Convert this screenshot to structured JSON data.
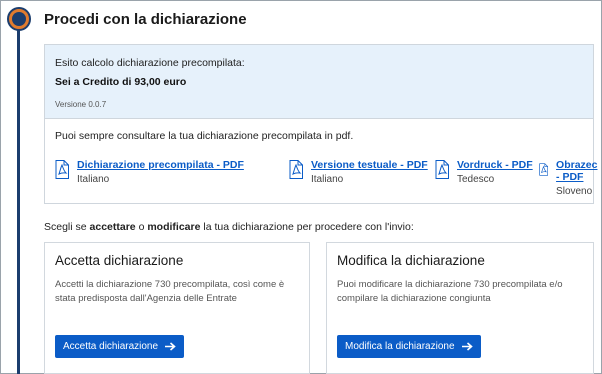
{
  "page_title": "Procedi con la dichiarazione",
  "summary": {
    "esito_label": "Esito calcolo dichiarazione precompilata:",
    "esito_value": "Sei a Credito di 93,00 euro",
    "version": "Versione 0.0.7"
  },
  "pdf_section": {
    "intro": "Puoi sempre consultare la tua dichiarazione precompilata in pdf.",
    "items": [
      {
        "name": "Dichiarazione precompilata - PDF",
        "lang": "Italiano"
      },
      {
        "name": "Versione testuale - PDF",
        "lang": "Italiano"
      },
      {
        "name": "Vordruck - PDF",
        "lang": "Tedesco"
      },
      {
        "name": "Obrazec - PDF",
        "lang": "Sloveno"
      }
    ]
  },
  "choose": {
    "before": "Scegli se ",
    "accept_word": "accettare",
    "middle": " o ",
    "modify_word": "modificare",
    "after": " la tua dichiarazione per procedere con l'invio:"
  },
  "cards": {
    "accept": {
      "title": "Accetta dichiarazione",
      "desc": "Accetti la dichiarazione 730 precompilata, così come è stata predisposta dall'Agenzia delle Entrate",
      "button": "Accetta dichiarazione"
    },
    "modify": {
      "title": "Modifica la dichiarazione",
      "desc": "Puoi modificare la dichiarazione 730 precompilata e/o compilare la dichiarazione congiunta",
      "button": "Modifica la dichiarazione"
    }
  },
  "colors": {
    "accent": "#0b5cc7",
    "timeline": "#1b3d6e",
    "step_marker": "#e07b2e",
    "summary_bg": "#e6f1fb"
  },
  "icons": {
    "pdf": "pdf-file-icon",
    "arrow": "arrow-right-icon"
  }
}
